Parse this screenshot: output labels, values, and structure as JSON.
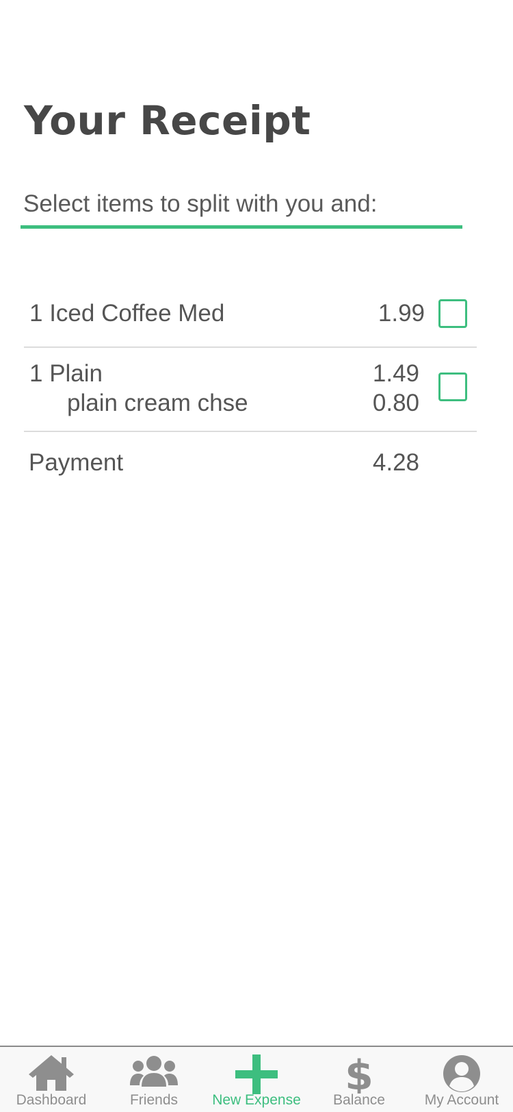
{
  "page": {
    "title": "Your Receipt"
  },
  "split": {
    "placeholder": "Select items to split with you and:",
    "value": ""
  },
  "receipt": {
    "items": [
      {
        "name": "1 Iced Coffee Med",
        "price": "1.99",
        "checked": false
      },
      {
        "name": "1 Plain",
        "price": "1.49",
        "sub_name": "plain cream chse",
        "sub_price": "0.80",
        "checked": false
      }
    ],
    "payment_label": "Payment",
    "payment_value": "4.28"
  },
  "tabbar": {
    "accent_color": "#3dbe7f",
    "inactive_color": "#8e8e8e",
    "tabs": [
      {
        "label": "Dashboard",
        "icon": "home-icon",
        "active": false
      },
      {
        "label": "Friends",
        "icon": "users-icon",
        "active": false
      },
      {
        "label": "New Expense",
        "icon": "plus-icon",
        "active": true
      },
      {
        "label": "Balance",
        "icon": "dollar-icon",
        "active": false
      },
      {
        "label": "My Account",
        "icon": "user-circle-icon",
        "active": false
      }
    ]
  }
}
